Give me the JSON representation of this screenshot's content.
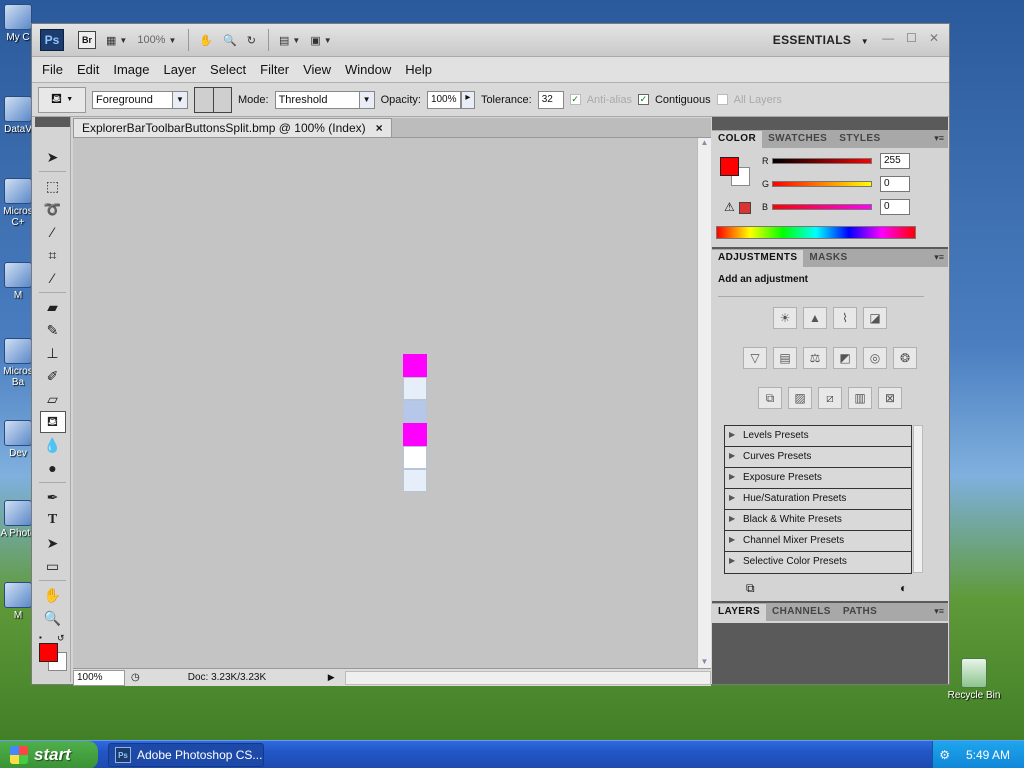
{
  "desktop": {
    "icons": [
      "My C",
      "DataV",
      "Micros C+",
      "M",
      "Micros Ba",
      "Dev",
      "A Photo",
      "M"
    ],
    "recycle_bin": "Recycle Bin"
  },
  "app": {
    "logo": "Ps",
    "bridge": "Br",
    "zoom_select": "100%",
    "workspace": "ESSENTIALS",
    "menus": [
      "File",
      "Edit",
      "Image",
      "Layer",
      "Select",
      "Filter",
      "View",
      "Window",
      "Help"
    ]
  },
  "options": {
    "fill_source": "Foreground",
    "mode_label": "Mode:",
    "mode_value": "Threshold",
    "opacity_label": "Opacity:",
    "opacity_value": "100%",
    "tolerance_label": "Tolerance:",
    "tolerance_value": "32",
    "anti_alias_label": "Anti-alias",
    "contiguous_label": "Contiguous",
    "all_layers_label": "All Layers"
  },
  "document": {
    "tab_title": "ExplorerBarToolbarButtonsSplit.bmp @ 100% (Index)",
    "close": "×",
    "zoom": "100%",
    "doc_info": "Doc: 3.23K/3.23K",
    "image_cells": [
      "#ff00ff",
      "#e6eefa",
      "#b6c8ea",
      "#ff00ff",
      "#ffffff",
      "#e6eefa"
    ]
  },
  "color_panel": {
    "tabs": [
      "COLOR",
      "SWATCHES",
      "STYLES"
    ],
    "channels": [
      {
        "label": "R",
        "value": "255",
        "gradient": "linear-gradient(90deg,#000,#f00)"
      },
      {
        "label": "G",
        "value": "0",
        "gradient": "linear-gradient(90deg,#f00,#ff0)"
      },
      {
        "label": "B",
        "value": "0",
        "gradient": "linear-gradient(90deg,#f00,#f0f)"
      }
    ],
    "foreground": "#ff0000",
    "background": "#ffffff"
  },
  "adjustments_panel": {
    "tabs": [
      "ADJUSTMENTS",
      "MASKS"
    ],
    "heading": "Add an adjustment",
    "presets": [
      "Levels Presets",
      "Curves Presets",
      "Exposure Presets",
      "Hue/Saturation Presets",
      "Black & White Presets",
      "Channel Mixer Presets",
      "Selective Color Presets"
    ]
  },
  "layers_panel": {
    "tabs": [
      "LAYERS",
      "CHANNELS",
      "PATHS"
    ]
  },
  "taskbar": {
    "start": "start",
    "task": "Adobe Photoshop CS...",
    "time": "5:49 AM"
  }
}
